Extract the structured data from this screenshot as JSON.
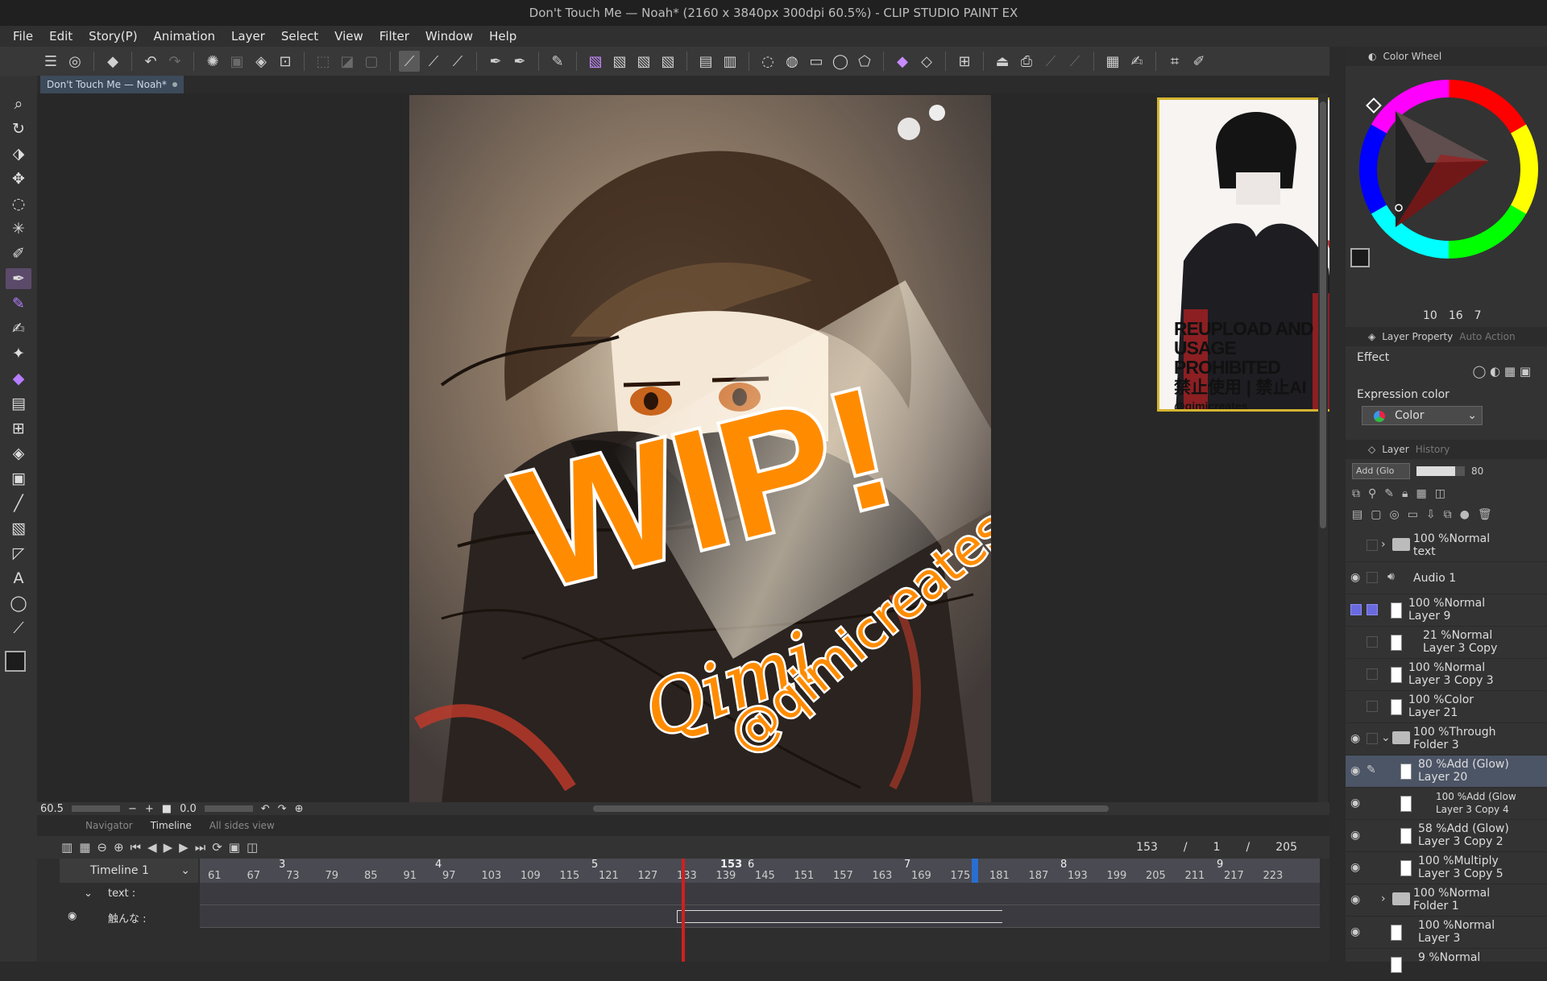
{
  "window": {
    "title": "Don't Touch Me — Noah* (2160 x 3840px 300dpi 60.5%)  - CLIP STUDIO PAINT EX"
  },
  "menu": [
    "File",
    "Edit",
    "Story(P)",
    "Animation",
    "Layer",
    "Select",
    "View",
    "Filter",
    "Window",
    "Help"
  ],
  "document_tab": {
    "label": "Don't Touch Me — Noah*"
  },
  "artwork": {
    "overlay_text": "WIP!",
    "signature": "Qimi",
    "watermark": "@qimicreates"
  },
  "reference": {
    "line1": "REUPLOAD AND USAGE",
    "line2": "PROHIBITED",
    "line3": "禁止使用 | 禁止AI",
    "line4": "@qimicreates"
  },
  "status": {
    "zoom": "60.5",
    "rotation": "0.0"
  },
  "timeline": {
    "tabs": [
      "Navigator",
      "Timeline",
      "All sides view"
    ],
    "name": "Timeline 1",
    "current_frame": "153",
    "start_frame": "1",
    "end_frame": "205",
    "playhead_label": "153",
    "seconds": [
      "3",
      "4",
      "5",
      "6",
      "7",
      "8",
      "9"
    ],
    "frames": [
      "61",
      "67",
      "73",
      "79",
      "85",
      "91",
      "97",
      "103",
      "109",
      "115",
      "121",
      "127",
      "133",
      "139",
      "145",
      "151",
      "157",
      "163",
      "169",
      "175",
      "181",
      "187",
      "193",
      "199",
      "205",
      "211",
      "217",
      "223"
    ],
    "tracks": [
      {
        "label": "text :"
      },
      {
        "label": "触んな :"
      }
    ]
  },
  "panels": {
    "color_wheel": {
      "title": "Color Wheel",
      "h": "10",
      "s": "16",
      "v": "7"
    },
    "layer_property": {
      "title": "Layer Property",
      "tab2": "Auto Action",
      "effect_label": "Effect",
      "expression_label": "Expression color",
      "expression_value": "Color"
    },
    "layer_panel": {
      "title": "Layer",
      "tab2": "History",
      "blend": "Add (Glo",
      "opacity": "80"
    }
  },
  "layers": [
    {
      "pct": "100 %Normal",
      "name": "text",
      "type": "folder",
      "collapsed": true
    },
    {
      "pct": "",
      "name": "Audio 1",
      "type": "audio"
    },
    {
      "pct": "100 %Normal",
      "name": "Layer 9",
      "type": "raster"
    },
    {
      "pct": "21 %Normal",
      "name": "Layer 3 Copy",
      "type": "raster"
    },
    {
      "pct": "100 %Normal",
      "name": "Layer 3 Copy 3",
      "type": "raster"
    },
    {
      "pct": "100 %Color",
      "name": "Layer 21",
      "type": "raster"
    },
    {
      "pct": "100 %Through",
      "name": "Folder 3",
      "type": "folder",
      "collapsed": false
    },
    {
      "pct": "80 %Add (Glow)",
      "name": "Layer 20",
      "type": "raster",
      "selected": true
    },
    {
      "pct": "100 %Add (Glow",
      "name": "Layer 3 Copy 4",
      "type": "raster"
    },
    {
      "pct": "58 %Add (Glow)",
      "name": "Layer 3 Copy 2",
      "type": "raster"
    },
    {
      "pct": "100 %Multiply",
      "name": "Layer 3 Copy 5",
      "type": "raster"
    },
    {
      "pct": "100 %Normal",
      "name": "Folder 1",
      "type": "folder",
      "collapsed": true
    },
    {
      "pct": "100 %Normal",
      "name": "Layer 3",
      "type": "raster"
    },
    {
      "pct": "9 %Normal",
      "name": "",
      "type": "raster"
    }
  ],
  "colors": {
    "accent": "#ff8c00",
    "frame": "#d4b430",
    "selection": "#4c5566",
    "playhead": "#d02020"
  }
}
